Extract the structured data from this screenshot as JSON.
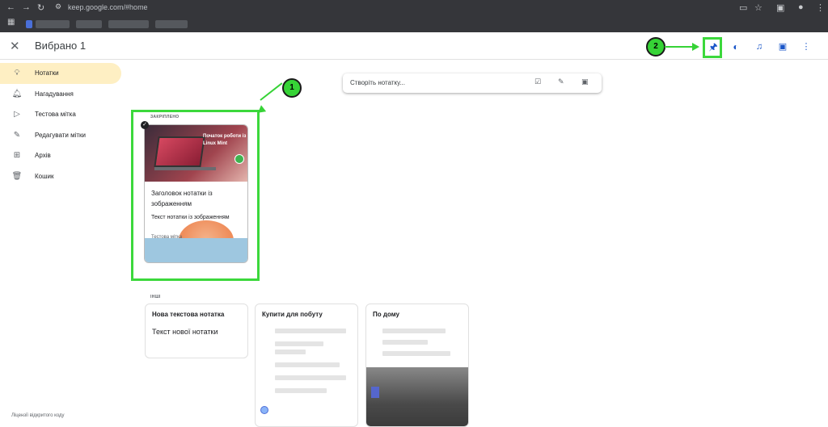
{
  "browser": {
    "url": "keep.google.com/#home"
  },
  "header": {
    "close_label": "✕",
    "selected_title": "Вибрано 1",
    "icons": [
      "pin-icon",
      "palette-icon",
      "reminder-bell-icon",
      "archive-icon",
      "more-vert-icon"
    ]
  },
  "annotations": {
    "badge1": "1",
    "badge2": "2"
  },
  "sidebar": {
    "items": [
      {
        "label": "Нотатки",
        "icon": "lightbulb-icon",
        "active": true
      },
      {
        "label": "Нагадування",
        "icon": "bell-icon",
        "active": false
      },
      {
        "label": "Тестова мітка",
        "icon": "label-icon",
        "active": false
      },
      {
        "label": "Редагувати мітки",
        "icon": "pencil-icon",
        "active": false
      },
      {
        "label": "Архів",
        "icon": "archive-icon",
        "active": false
      },
      {
        "label": "Кошик",
        "icon": "trash-icon",
        "active": false
      }
    ],
    "license": "Ліцензії відкритого коду"
  },
  "create_note": {
    "placeholder": "Створіть нотатку..."
  },
  "sections": {
    "pinned": "ЗАКРІПЛЕНО",
    "others": "ІНШІ"
  },
  "pinned_note": {
    "image_text": "Початок роботи із Linux Mint",
    "title": "Заголовок нотатки із зображенням",
    "text": "Текст нотатки із зображенням",
    "label": "Тестова мітка"
  },
  "notes": [
    {
      "title": "Нова текстова нотатка",
      "text": "Текст нової нотатки"
    },
    {
      "title": "Купити для побуту",
      "text": ""
    },
    {
      "title": "По дому",
      "text": ""
    }
  ]
}
